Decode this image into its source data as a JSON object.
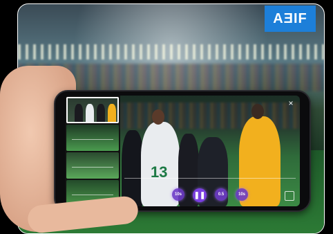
{
  "background": {
    "board_text": "AƎIF"
  },
  "player_ui": {
    "close_symbol": "×",
    "jersey_number": "13",
    "controls": {
      "rewind_label": "10s",
      "pause_symbol": "❚❚",
      "speed_label": "0.5",
      "forward_label": "10s"
    },
    "progress_fraction": 0.55
  },
  "colors": {
    "accent": "#7a3fe0",
    "board": "#1d7fd9",
    "home_kit": "#f2b01e"
  }
}
